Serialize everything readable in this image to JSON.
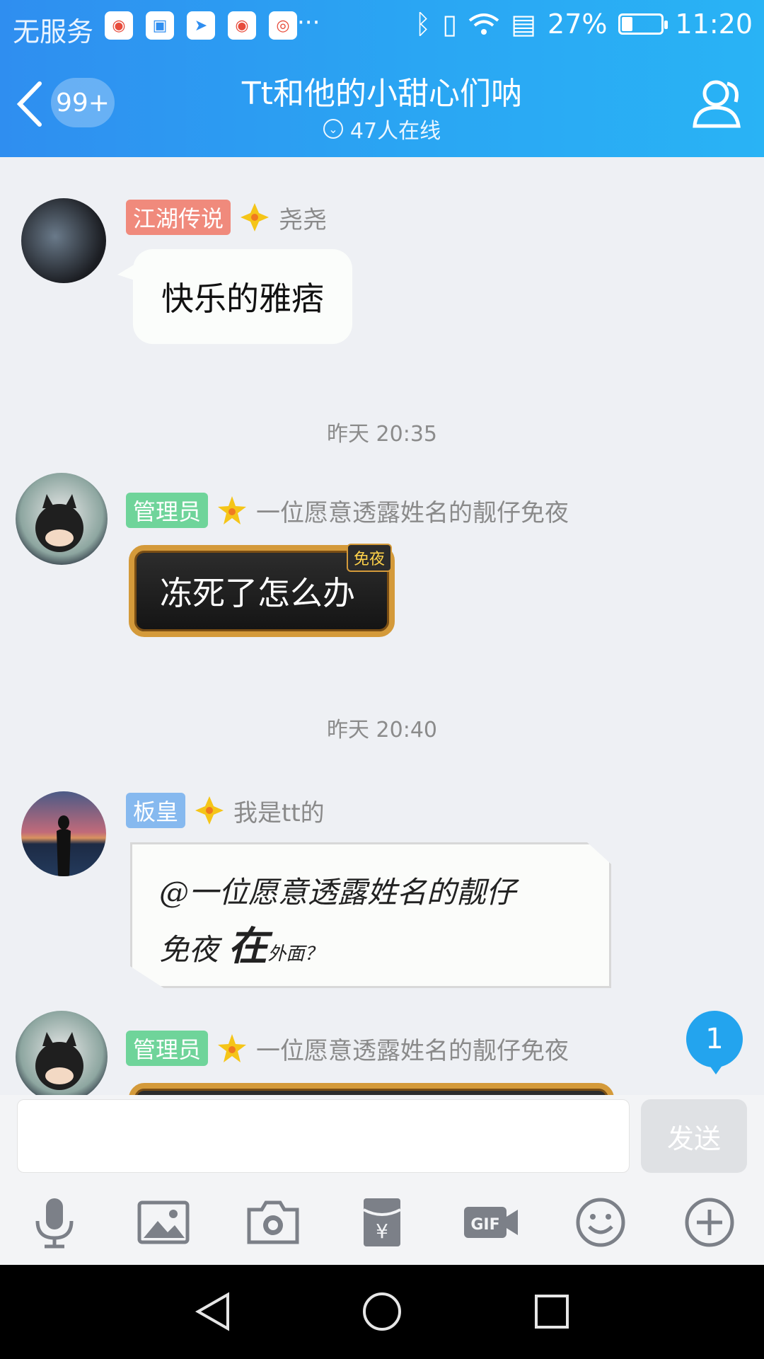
{
  "status_bar": {
    "carrier": "无服务",
    "more": "···",
    "battery_text": "27%",
    "battery_level": 0.27,
    "time": "11:20"
  },
  "header": {
    "unread_count": "99+",
    "title": "Tt和他的小甜心们呐",
    "online": "47人在线"
  },
  "messages": [
    {
      "tag": "江湖传说",
      "tag_color": "#f08a7c",
      "nick": "尧尧",
      "text": "快乐的雅痞",
      "style": "white"
    },
    {
      "time": "昨天 20:35"
    },
    {
      "tag": "管理员",
      "tag_color": "#6fd49a",
      "nick": "一位愿意透露姓名的靓仔免夜",
      "text": "冻死了怎么办",
      "style": "dark",
      "badge": "免夜"
    },
    {
      "time": "昨天 20:40"
    },
    {
      "tag": "板皇",
      "tag_color": "#86b9ef",
      "nick": "我是tt的",
      "text_line1": "@一位愿意透露姓名的靓仔",
      "text_line2_a": "免夜 ",
      "text_line2_b": "在",
      "text_line2_c": "外面？",
      "style": "paper"
    },
    {
      "tag": "管理员",
      "tag_color": "#6fd49a",
      "nick": "一位愿意透露姓名的靓仔免夜",
      "style": "dark-partial"
    }
  ],
  "new_message_badge": "1",
  "composer": {
    "input_value": "",
    "send_label": "发送"
  },
  "toolbar_icons": [
    "microphone-icon",
    "image-icon",
    "camera-icon",
    "red-packet-icon",
    "gif-icon",
    "emoji-icon",
    "plus-icon"
  ],
  "colors": {
    "header_start": "#2f8ef0",
    "header_end": "#29b3f5",
    "accent": "#23a4ee"
  }
}
